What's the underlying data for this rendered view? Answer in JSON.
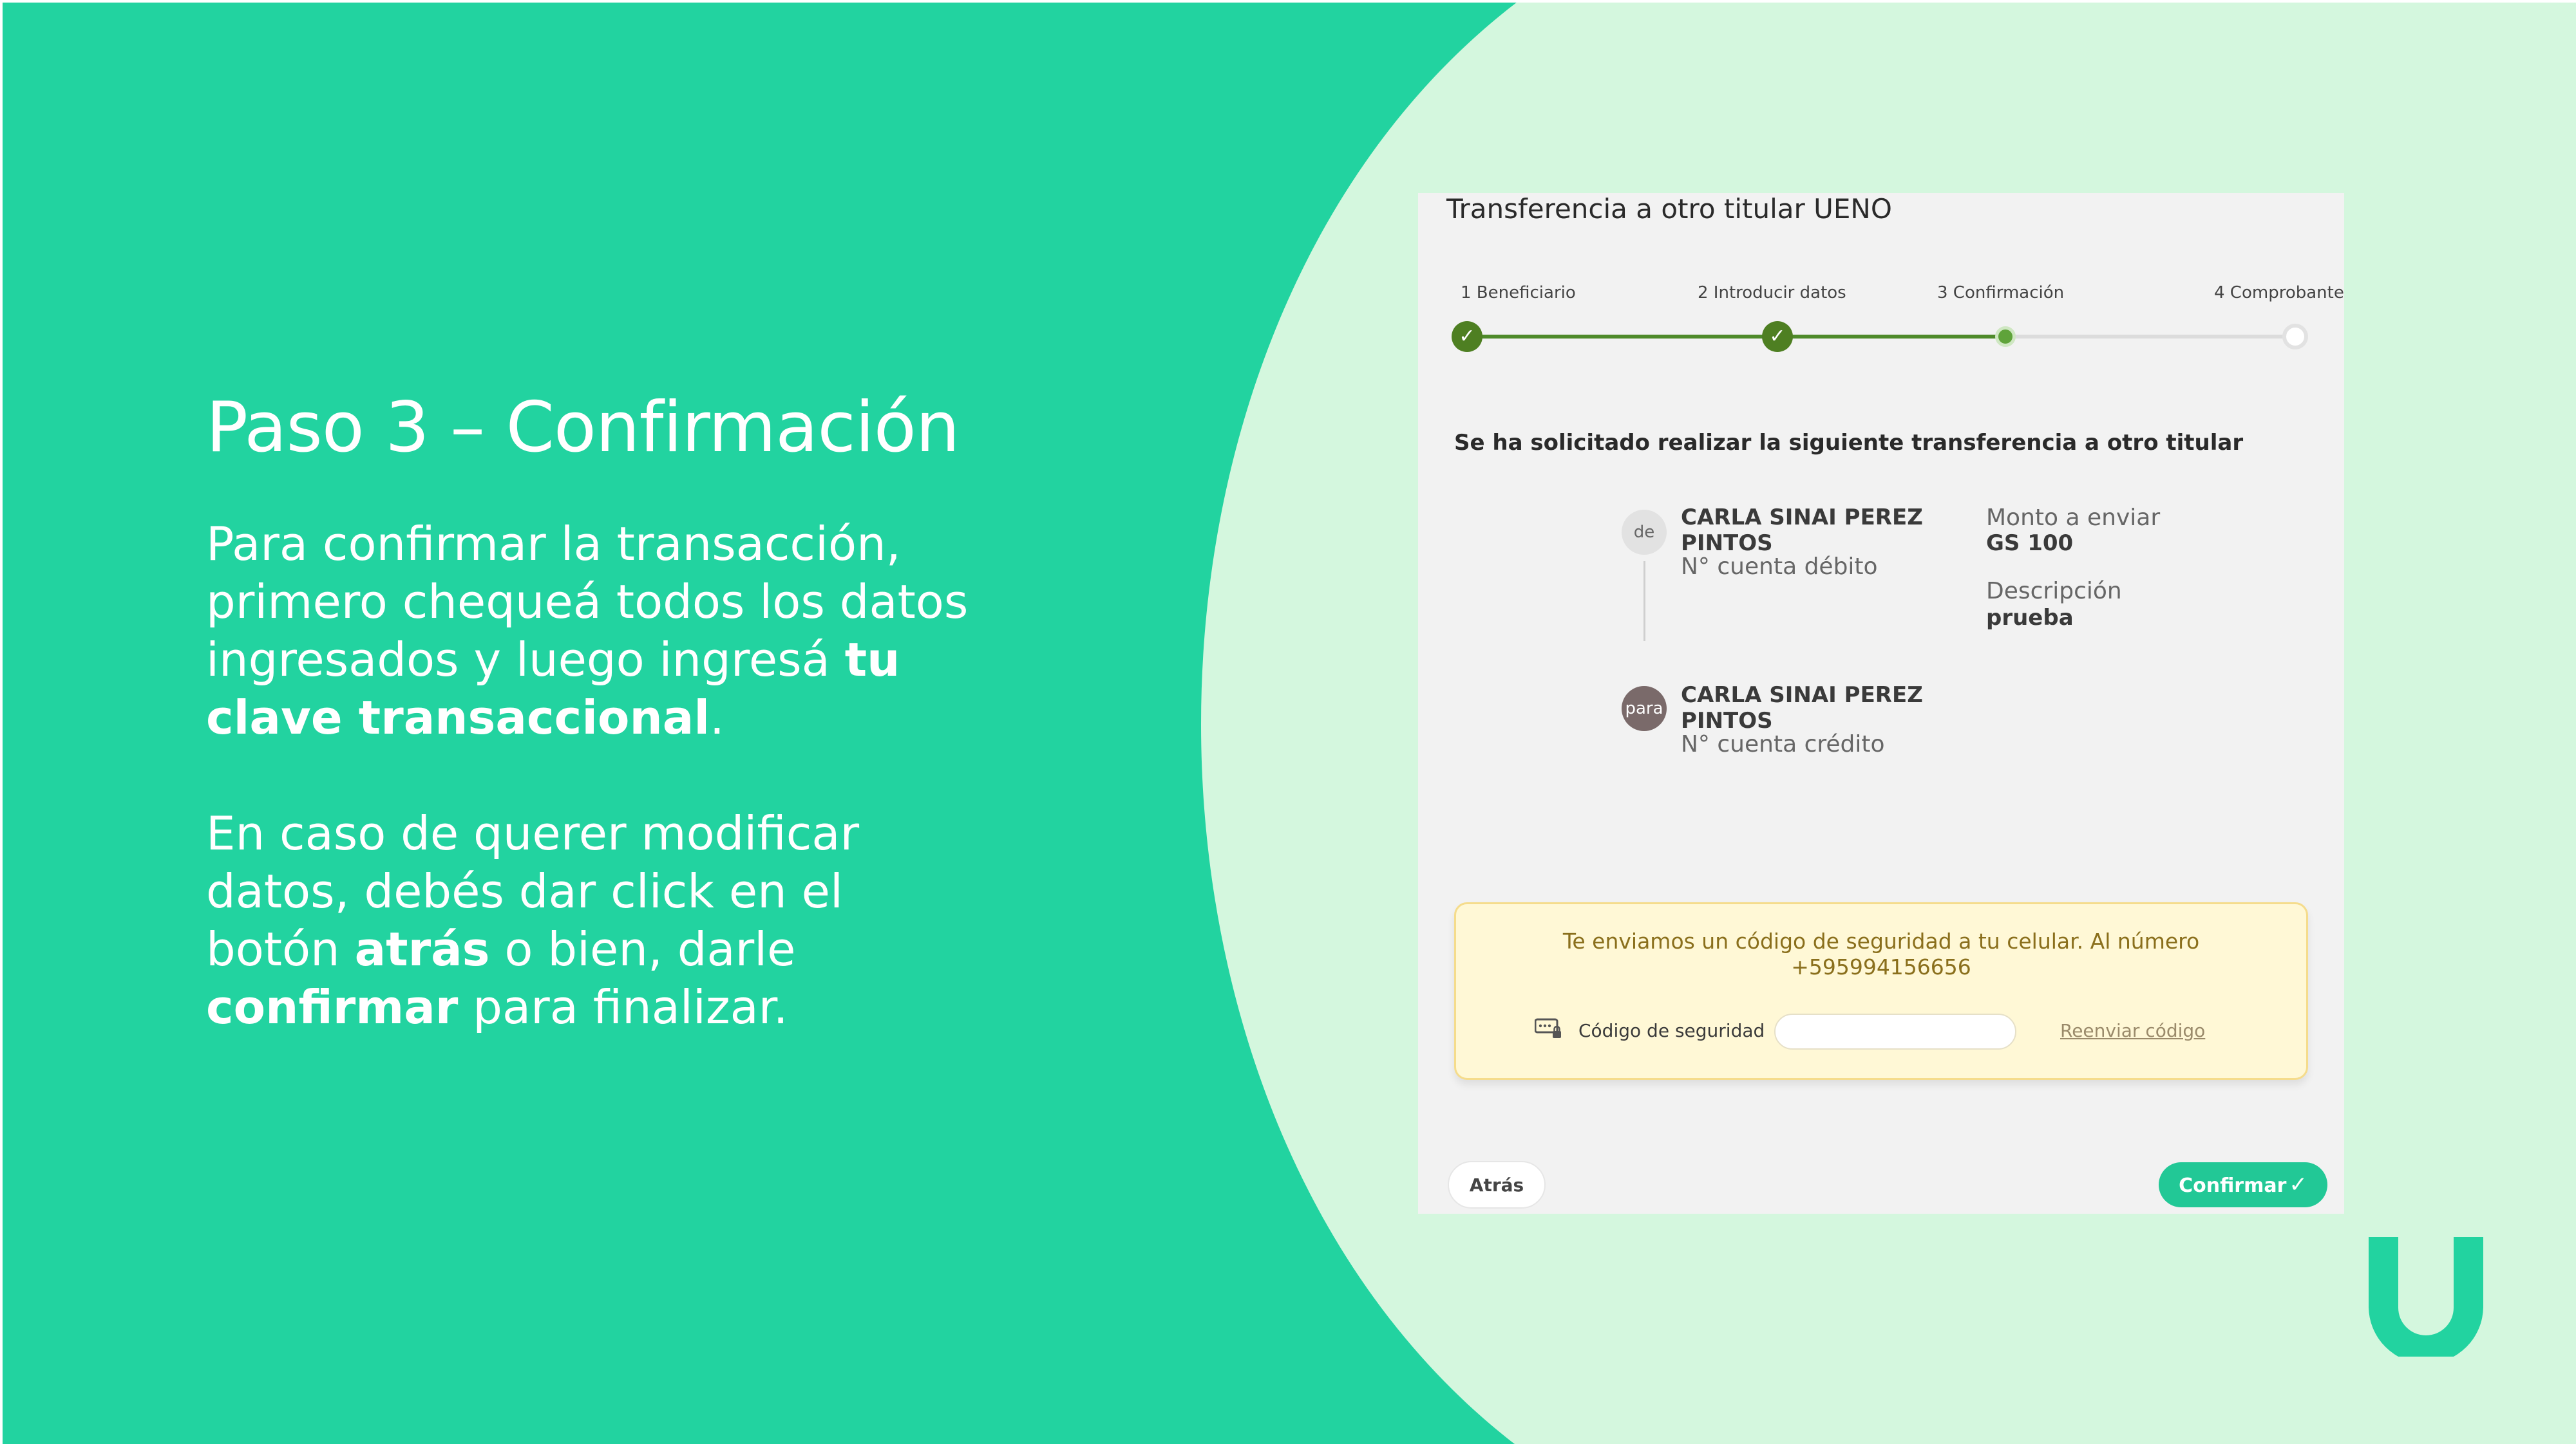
{
  "colors": {
    "brand_green": "#22d3a0",
    "background_mint": "#d4f7de",
    "step_done": "#4e7f22",
    "confirm_button": "#22c896",
    "alert_background": "#fff8d6",
    "alert_text": "#8a6f1c"
  },
  "left": {
    "heading": "Paso 3 – Confirmación",
    "para1_plain": "Para confirmar la transacción, primero chequeá todos los datos ingresados y luego ingresá ",
    "para1_bold": "tu clave transaccional",
    "para1_end": ".",
    "para2_plain1": "En caso de querer modificar datos, debés dar click en el botón ",
    "para2_bold1": "atrás",
    "para2_plain2": " o bien, darle ",
    "para2_bold2": "confirmar",
    "para2_end": " para finalizar."
  },
  "panel": {
    "title": "Transferencia a otro titular UENO",
    "steps": [
      {
        "label": "1 Beneficiario",
        "status": "done"
      },
      {
        "label": "2 Introducir datos",
        "status": "done"
      },
      {
        "label": "3 Confirmación",
        "status": "current"
      },
      {
        "label": "4 Comprobante",
        "status": "pending"
      }
    ],
    "progress_fraction": 0.67,
    "summary_heading": "Se ha solicitado realizar la siguiente transferencia a otro titular",
    "from": {
      "badge": "de",
      "name": "CARLA SINAI PEREZ PINTOS",
      "account_label": "N° cuenta débito"
    },
    "to": {
      "badge": "para",
      "name": "CARLA SINAI PEREZ PINTOS",
      "account_label": "N° cuenta crédito"
    },
    "amount_label": "Monto a enviar",
    "amount_value": "GS 100",
    "description_label": "Descripción",
    "description_value": "prueba",
    "security": {
      "message": "Te enviamos un código de seguridad a tu celular. Al número +595994156656",
      "code_label": "Código de seguridad",
      "code_value": "",
      "resend_label": "Reenviar código"
    },
    "back_label": "Atrás",
    "confirm_label": "Confirmar",
    "icons": {
      "step_done": "check-icon",
      "confirm": "check-icon",
      "security_code": "keypad-lock-icon"
    }
  },
  "brand": {
    "logo_icon": "ueno-u-logo-icon"
  }
}
